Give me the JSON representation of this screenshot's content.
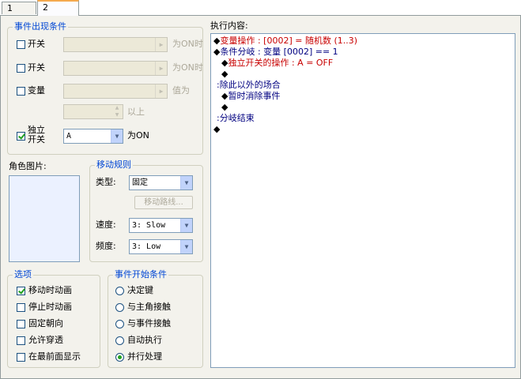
{
  "tabs": [
    {
      "label": "1"
    },
    {
      "label": "2"
    }
  ],
  "event_conditions": {
    "title": "事件出现条件",
    "switch1_label": "开关",
    "switch1_suffix": "为ON时",
    "switch2_label": "开关",
    "switch2_suffix": "为ON时",
    "variable_label": "变量",
    "variable_suffix": "值为",
    "variable_above": "以上",
    "self_switch_label_1": "独立",
    "self_switch_label_2": "开关",
    "self_switch_value": "A",
    "self_switch_suffix": "为ON"
  },
  "character_image": {
    "label": "角色图片:"
  },
  "movement": {
    "title": "移动规则",
    "type_label": "类型:",
    "type_value": "固定",
    "route_button": "移动路线...",
    "speed_label": "速度:",
    "speed_value": "3: Slow",
    "freq_label": "频度:",
    "freq_value": "3: Low"
  },
  "options": {
    "title": "选项",
    "items": [
      {
        "label": "移动时动画",
        "checked": true
      },
      {
        "label": "停止时动画",
        "checked": false
      },
      {
        "label": "固定朝向",
        "checked": false
      },
      {
        "label": "允许穿透",
        "checked": false
      },
      {
        "label": "在最前面显示",
        "checked": false
      }
    ]
  },
  "trigger": {
    "title": "事件开始条件",
    "items": [
      {
        "label": "决定键",
        "selected": false
      },
      {
        "label": "与主角接触",
        "selected": false
      },
      {
        "label": "与事件接触",
        "selected": false
      },
      {
        "label": "自动执行",
        "selected": false
      },
      {
        "label": "并行处理",
        "selected": true
      }
    ]
  },
  "execution": {
    "label": "执行内容:",
    "lines": [
      {
        "prefix": "◆",
        "text": "变量操作 : [0002] = 随机数 (1..3)",
        "color": "#c80000"
      },
      {
        "prefix": "◆",
        "text": "条件分岐 : 变量 [0002] == 1",
        "color": "#000080"
      },
      {
        "prefix": " ◆",
        "text": "独立开关的操作 : A = OFF",
        "color": "#c80000"
      },
      {
        "prefix": " ◆",
        "text": "",
        "color": "#000000"
      },
      {
        "prefix": " :",
        "text": "除此以外的场合",
        "color": "#000080"
      },
      {
        "prefix": " ◆",
        "text": "暂时消除事件",
        "color": "#000080"
      },
      {
        "prefix": " ◆",
        "text": "",
        "color": "#000000"
      },
      {
        "prefix": " :",
        "text": "分岐结束",
        "color": "#000080"
      },
      {
        "prefix": "◆",
        "text": "",
        "color": "#000000"
      }
    ]
  },
  "colors": {
    "group_title": "#0046d5",
    "panel_bg": "#f3f2ec",
    "active_tab_accent": "#f5a94e"
  }
}
